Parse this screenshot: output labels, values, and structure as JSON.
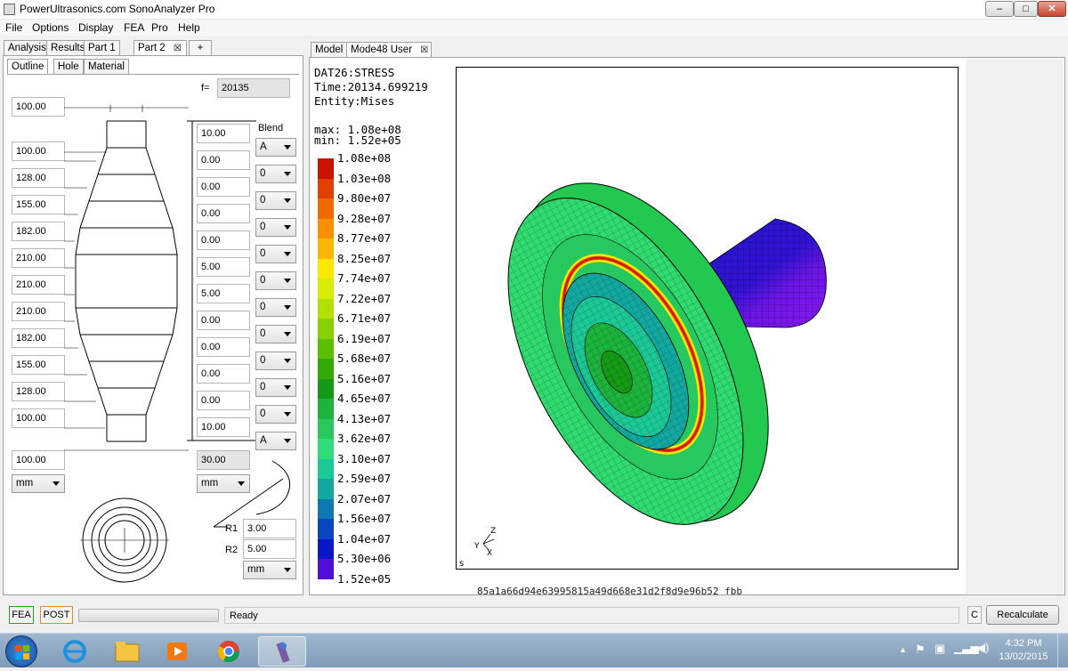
{
  "window": {
    "title": "PowerUltrasonics.com SonoAnalyzer Pro",
    "minimize": "–",
    "maximize": "□",
    "close": "✕"
  },
  "menu": [
    "File",
    "Options",
    "Display",
    "FEA",
    "Pro",
    "Help"
  ],
  "left_tabs": [
    "Analysis",
    "Results",
    "Part 1",
    "Part 2",
    "+"
  ],
  "sub_tabs": [
    "Outline",
    "Hole",
    "Material"
  ],
  "freq_label": "f=",
  "freq_value": "20135",
  "diameters": [
    "100.00",
    "100.00",
    "128.00",
    "155.00",
    "182.00",
    "210.00",
    "210.00",
    "210.00",
    "182.00",
    "155.00",
    "128.00",
    "100.00",
    "100.00"
  ],
  "lengths": [
    "10.00",
    "0.00",
    "0.00",
    "0.00",
    "0.00",
    "5.00",
    "5.00",
    "0.00",
    "0.00",
    "0.00",
    "0.00",
    "10.00"
  ],
  "blend_label": "Blend",
  "blends": [
    "A",
    "0",
    "0",
    "0",
    "0",
    "0",
    "0",
    "0",
    "0",
    "0",
    "0",
    "A",
    "0"
  ],
  "total_length": "30.00",
  "unit_left": "mm",
  "unit_mid": "mm",
  "r1_label": "R1",
  "r1_value": "3.00",
  "r2_label": "R2",
  "r2_value": "5.00",
  "unit_r": "mm",
  "right_tabs": [
    "Model",
    "Mode48 User"
  ],
  "info": {
    "line1": "DAT26:STRESS",
    "line2": "Time:20134.699219",
    "line3": "Entity:Mises",
    "max": "max: 1.08e+08",
    "min": "min: 1.52e+05"
  },
  "legend": [
    {
      "label": "1.08e+08",
      "color": "#c81400"
    },
    {
      "label": "1.03e+08",
      "color": "#e04000"
    },
    {
      "label": "9.80e+07",
      "color": "#f06a00"
    },
    {
      "label": "9.28e+07",
      "color": "#f89000"
    },
    {
      "label": "8.77e+07",
      "color": "#fcb800"
    },
    {
      "label": "8.25e+07",
      "color": "#fce800"
    },
    {
      "label": "7.74e+07",
      "color": "#d8ec00"
    },
    {
      "label": "7.22e+07",
      "color": "#b4e000"
    },
    {
      "label": "6.71e+07",
      "color": "#88d000"
    },
    {
      "label": "6.19e+07",
      "color": "#5cbe00"
    },
    {
      "label": "5.68e+07",
      "color": "#32aa00"
    },
    {
      "label": "5.16e+07",
      "color": "#149a14"
    },
    {
      "label": "4.65e+07",
      "color": "#1cb43c"
    },
    {
      "label": "4.13e+07",
      "color": "#28c85a"
    },
    {
      "label": "3.62e+07",
      "color": "#30dc78"
    },
    {
      "label": "3.10e+07",
      "color": "#1cc896"
    },
    {
      "label": "2.59e+07",
      "color": "#12a8a0"
    },
    {
      "label": "2.07e+07",
      "color": "#0e78b0"
    },
    {
      "label": "1.56e+07",
      "color": "#0a46c0"
    },
    {
      "label": "1.04e+07",
      "color": "#0a16c8"
    },
    {
      "label": "5.30e+06",
      "color": "#5010d8"
    },
    {
      "label": "1.52e+05",
      "color": "#8a14f0"
    }
  ],
  "corner_label": "s",
  "axis_labels": {
    "x": "X",
    "y": "Y",
    "z": "Z"
  },
  "hash_text": "85a1a66d94e63995815a49d668e31d2f8d9e96b52 fbb",
  "status": {
    "fea": "FEA",
    "post": "POST",
    "text": "Ready",
    "c": "C",
    "recalculate": "Recalculate"
  },
  "tray": {
    "time": "4:32 PM",
    "date": "13/02/2015"
  }
}
